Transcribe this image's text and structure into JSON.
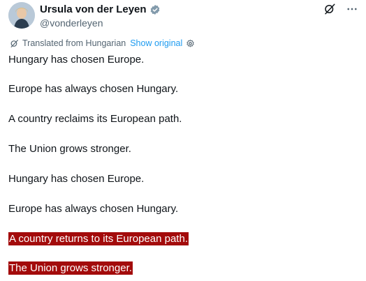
{
  "author": {
    "display_name": "Ursula von der Leyen",
    "handle": "@vonderleyen",
    "verified_icon": "verified-badge-icon",
    "avatar": "avatar-photo"
  },
  "header_actions": {
    "grok_icon": "grok-icon",
    "more_label": "···"
  },
  "translation": {
    "label": "Translated from Hungarian",
    "show_original": "Show original",
    "settings_icon": "settings-icon"
  },
  "post": {
    "lines": [
      "Hungary has chosen Europe.",
      "Europe has always chosen Hungary.",
      "A country reclaims its European path.",
      "The Union grows stronger.",
      "Hungary has chosen Europe.",
      "Europe has always chosen Hungary.",
      "A country returns to its European path.",
      "The Union grows stronger."
    ]
  },
  "colors": {
    "text": "#0f1419",
    "muted": "#536471",
    "link": "#1d9bf0",
    "verified": "#829aab",
    "highlight_bg": "#a30b0b",
    "highlight_text": "#ffffff"
  }
}
